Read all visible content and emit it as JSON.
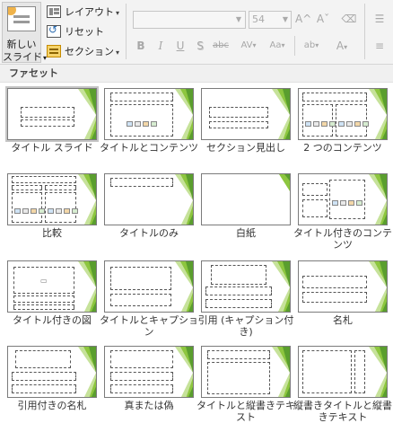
{
  "ribbon": {
    "new_slide_label_line1": "新しい",
    "new_slide_label_line2": "スライド",
    "layout_label": "レイアウト",
    "reset_label": "リセット",
    "section_label": "セクション",
    "font_name_value": "",
    "font_size_value": "54",
    "grow_font_icon": "A^",
    "shrink_font_icon": "Aˇ",
    "bold_label": "B",
    "italic_label": "I",
    "underline_label": "U",
    "shadow_label": "S",
    "strike_label": "abc",
    "spacing_label": "AV",
    "case_label": "Aa",
    "highlight_label": "ab",
    "font_color_label": "A"
  },
  "gallery": {
    "header": "ファセット",
    "layouts": [
      {
        "label": "タイトル スライド",
        "selected": true
      },
      {
        "label": "タイトルとコンテンツ",
        "selected": false
      },
      {
        "label": "セクション見出し",
        "selected": false
      },
      {
        "label": "2 つのコンテンツ",
        "selected": false
      },
      {
        "label": "比較",
        "selected": false
      },
      {
        "label": "タイトルのみ",
        "selected": false
      },
      {
        "label": "白紙",
        "selected": false
      },
      {
        "label": "タイトル付きのコンテンツ",
        "selected": false
      },
      {
        "label": "タイトル付きの図",
        "selected": false
      },
      {
        "label": "タイトルとキャプション",
        "selected": false
      },
      {
        "label": "引用 (キャプション付き)",
        "selected": false
      },
      {
        "label": "名札",
        "selected": false
      },
      {
        "label": "引用付きの名札",
        "selected": false
      },
      {
        "label": "真または偽",
        "selected": false
      },
      {
        "label": "タイトルと縦書きテキスト",
        "selected": false
      },
      {
        "label": "縦書きタイトルと縦書きテキスト",
        "selected": false
      }
    ]
  },
  "colors": {
    "accent_green_dark": "#5a9e2e",
    "accent_green_mid": "#8dc63f",
    "accent_green_light": "#c6e29a"
  }
}
